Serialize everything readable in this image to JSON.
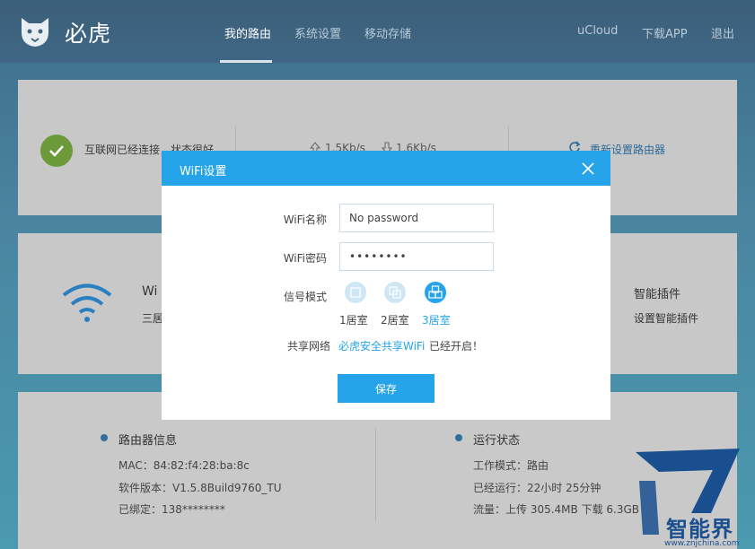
{
  "header": {
    "brand": "必虎",
    "nav": [
      "我的路由",
      "系统设置",
      "移动存储"
    ],
    "right": [
      "uCloud",
      "下载APP",
      "退出"
    ]
  },
  "status": {
    "internet": "互联网已经连接，状态很好",
    "upload_speed": "1.5Kb/s",
    "download_speed": "1.6Kb/s",
    "reset": "重新设置路由器"
  },
  "wifi_panel": {
    "title_partial": "Wi",
    "subtitle_partial": "三居",
    "plugin_title": "智能插件",
    "plugin_sub": "设置智能插件"
  },
  "router_info": {
    "title": "路由器信息",
    "mac": "MAC：84:82:f4:28:ba:8c",
    "version": "软件版本：V1.5.8Build9760_TU",
    "bound": "已绑定：138********"
  },
  "run_status": {
    "title": "运行状态",
    "mode": "工作模式：路由",
    "uptime": "已经运行：22小时 25分钟",
    "traffic": "流量：上传 305.4MB 下载 6.3GB"
  },
  "modal": {
    "title": "WiFi设置",
    "name_label": "WiFi名称",
    "name_value": "No password",
    "pwd_label": "WiFi密码",
    "pwd_value": "••••••••",
    "mode_label": "信号模式",
    "modes": [
      "1居室",
      "2居室",
      "3居室"
    ],
    "selected_mode": 2,
    "share_label": "共享网络",
    "share_link": "必虎安全共享WiFi",
    "share_status": "已经开启！",
    "save": "保存"
  },
  "watermark": {
    "text": "智能界",
    "url": "www.znjchina.com"
  },
  "colors": {
    "accent": "#26a4ea",
    "header": "#3f6785",
    "ok": "#6d9a38"
  }
}
